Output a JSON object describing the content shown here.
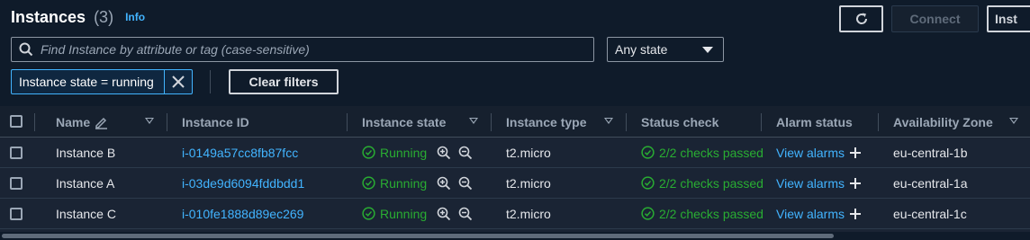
{
  "header": {
    "title": "Instances",
    "count": "(3)",
    "info_label": "Info",
    "connect_label": "Connect",
    "instance_btn_label": "Inst"
  },
  "search": {
    "placeholder": "Find Instance by attribute or tag (case-sensitive)",
    "value": ""
  },
  "state_filter": {
    "selected": "Any state"
  },
  "filter_token": {
    "label": "Instance state = running"
  },
  "clear_filters_label": "Clear filters",
  "columns": [
    "Name",
    "Instance ID",
    "Instance state",
    "Instance type",
    "Status check",
    "Alarm status",
    "Availability Zone"
  ],
  "rows": [
    {
      "name": "Instance B",
      "id": "i-0149a57cc8fb87fcc",
      "state": "Running",
      "type": "t2.micro",
      "status": "2/2 checks passed",
      "alarm": "View alarms",
      "zone": "eu-central-1b"
    },
    {
      "name": "Instance A",
      "id": "i-03de9d6094fddbdd1",
      "state": "Running",
      "type": "t2.micro",
      "status": "2/2 checks passed",
      "alarm": "View alarms",
      "zone": "eu-central-1a"
    },
    {
      "name": "Instance C",
      "id": "i-010fe1888d89ec269",
      "state": "Running",
      "type": "t2.micro",
      "status": "2/2 checks passed",
      "alarm": "View alarms",
      "zone": "eu-central-1c"
    }
  ],
  "icons": {
    "refresh": "refresh-icon",
    "search": "search-icon",
    "dropdown": "caret-down-icon",
    "close": "close-icon",
    "edit": "pencil-icon",
    "sort": "sort-icon",
    "status": "check-circle-icon",
    "zoom_in": "zoom-in-icon",
    "zoom_out": "zoom-out-icon",
    "add": "plus-icon"
  },
  "colors": {
    "background": "#0f1b2a",
    "link": "#42b4ff",
    "success": "#29ad32",
    "text": "#e5e7eb"
  }
}
